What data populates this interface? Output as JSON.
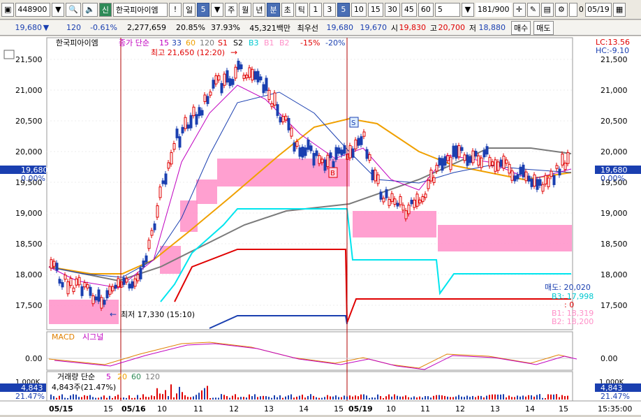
{
  "toolbar": {
    "code": "448900",
    "shin_label": "신",
    "name": "한국피아이엠",
    "bang_label": "!",
    "period_il": "일",
    "period_num": "5",
    "periods": [
      "주",
      "월",
      "년",
      "분",
      "초",
      "틱"
    ],
    "intervals": [
      "1",
      "3",
      "5",
      "10",
      "15",
      "30",
      "45",
      "60"
    ],
    "interval_selected": "5",
    "count_select": "5",
    "page_count": "181",
    "page_total": "/900",
    "checkbox_label": "0",
    "date": "05/19"
  },
  "quote": {
    "price": "19,680",
    "change": "120",
    "change_pct": "-0.61%",
    "volume": "2,277,659",
    "turnover_pct": "20.85%",
    "ratio": "37.93%",
    "amount": "45,321백만",
    "best_label": "최우선",
    "best_ask": "19,680",
    "best_bid": "19,670",
    "open_label": "시",
    "open": "19,830",
    "high_label": "고",
    "high": "20,700",
    "low_label": "저",
    "low": "18,880",
    "buy_label": "매수",
    "sell_label": "매도"
  },
  "legend": {
    "name": "한국피아이엠",
    "ma_label": "종가 단순",
    "ma_periods": [
      "15",
      "33",
      "60",
      "120"
    ],
    "ichimoku": [
      "S1",
      "S2",
      "B3",
      "B1",
      "B2"
    ],
    "envelope": [
      "-15%",
      "-20%"
    ]
  },
  "annotations": {
    "high": "최고 21,650 (12:20)",
    "low": "최저 17,330 (15:10)",
    "lc": "LC:13.56",
    "hc": "HC:-9.10",
    "b_marker": "B",
    "s_marker": "S",
    "sell_label": "매도: 20,020",
    "b3": "B3: 17,998",
    "b3_zero": ": 0",
    "b1": "B1: 18,319",
    "b2": "B2: 18,200"
  },
  "price_axis": {
    "ticks": [
      "21,500",
      "21,000",
      "20,500",
      "20,000",
      "19,500",
      "19,000",
      "18,500",
      "18,000",
      "17,500"
    ],
    "current": "19,680",
    "current_pct": "0.00%"
  },
  "macd": {
    "label": "MACD",
    "signal_label": "시그널",
    "zero": "0.00"
  },
  "volume_panel": {
    "label": "거래량 단순",
    "periods": [
      "5",
      "20",
      "60",
      "120"
    ],
    "current": "4,843주(21.47%)",
    "axis_top": "1,000K",
    "axis_value": "4,843",
    "axis_pct": "21.47%"
  },
  "xaxis": {
    "dates": [
      "05/15",
      "05/16",
      "05/19"
    ],
    "hours": [
      "15",
      "10",
      "11",
      "12",
      "13",
      "14",
      "15",
      "10",
      "11",
      "12",
      "13",
      "14",
      "15"
    ],
    "time": "15:35:00"
  },
  "colors": {
    "up": "#e00000",
    "down": "#1a3fb0",
    "pink": "#ff8fc8",
    "cyan": "#00e5ee",
    "orange": "#f0a000",
    "gray": "#7a7a7a",
    "magenta": "#c000c0"
  }
}
